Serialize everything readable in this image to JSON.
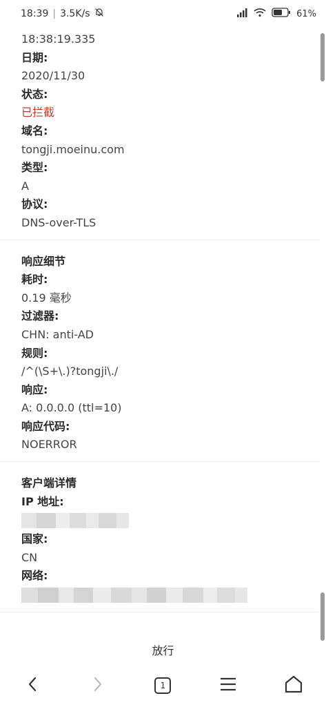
{
  "status_bar": {
    "time": "18:39",
    "speed": "3.5K/s",
    "battery": "61"
  },
  "query": {
    "time_value": "18:38:19.335",
    "date_label": "日期:",
    "date_value": "2020/11/30",
    "status_label": "状态:",
    "status_value": "已拦截",
    "domain_label": "域名:",
    "domain_value": "tongji.moeinu.com",
    "type_label": "类型:",
    "type_value": "A",
    "protocol_label": "协议:",
    "protocol_value": "DNS-over-TLS"
  },
  "response": {
    "title": "响应细节",
    "elapsed_label": "耗时:",
    "elapsed_value": "0.19 毫秒",
    "filter_label": "过滤器:",
    "filter_value": "CHN: anti-AD",
    "rule_label": "规则:",
    "rule_value": "/^(\\S+\\.)?tongji\\./",
    "answer_label": "响应:",
    "answer_value": "A: 0.0.0.0 (ttl=10)",
    "code_label": "响应代码:",
    "code_value": "NOERROR"
  },
  "client": {
    "title": "客户端详情",
    "ip_label": "IP 地址:",
    "country_label": "国家:",
    "country_value": "CN",
    "network_label": "网络:"
  },
  "actions": {
    "allow_label": "放行"
  },
  "nav": {
    "tab_count": "1"
  }
}
